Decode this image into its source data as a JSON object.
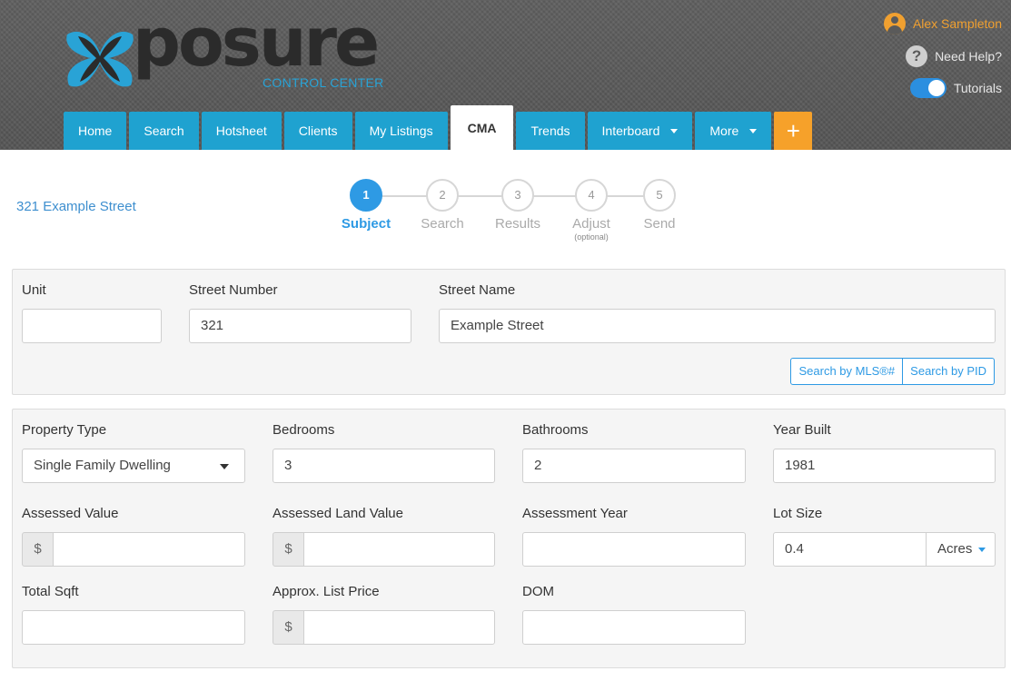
{
  "brand": {
    "logo_text": "posure",
    "logo_subtitle": "CONTROL CENTER",
    "logo_icon": "x-butterfly-logo-icon",
    "accent_color": "#29a3d6"
  },
  "user": {
    "name": "Alex Sampleton",
    "user_icon": "user-icon",
    "help_label": "Need Help?",
    "help_icon": "question-icon",
    "tutorials_label": "Tutorials",
    "tutorials_enabled": true
  },
  "nav": {
    "tabs": [
      {
        "label": "Home"
      },
      {
        "label": "Search"
      },
      {
        "label": "Hotsheet"
      },
      {
        "label": "Clients"
      },
      {
        "label": "My Listings"
      },
      {
        "label": "CMA",
        "active": true
      },
      {
        "label": "Trends"
      },
      {
        "label": "Interboard",
        "dropdown": true
      },
      {
        "label": "More",
        "dropdown": true
      },
      {
        "label": "+"
      }
    ],
    "tab_color": "#1fa2d0",
    "plus_color": "#f6a12a"
  },
  "subject_address": "321 Example Street",
  "wizard": {
    "steps": [
      {
        "number": "1",
        "label": "Subject",
        "active": true
      },
      {
        "number": "2",
        "label": "Search"
      },
      {
        "number": "3",
        "label": "Results"
      },
      {
        "number": "4",
        "label": "Adjust",
        "sublabel": "(optional)"
      },
      {
        "number": "5",
        "label": "Send"
      }
    ]
  },
  "address_panel": {
    "unit": {
      "label": "Unit",
      "value": ""
    },
    "street_number": {
      "label": "Street Number",
      "value": "321"
    },
    "street_name": {
      "label": "Street Name",
      "value": "Example Street"
    },
    "search_mls_label": "Search by MLS®#",
    "search_pid_label": "Search by PID"
  },
  "details_panel": {
    "property_type": {
      "label": "Property Type",
      "value": "Single Family Dwelling"
    },
    "bedrooms": {
      "label": "Bedrooms",
      "value": "3"
    },
    "bathrooms": {
      "label": "Bathrooms",
      "value": "2"
    },
    "year_built": {
      "label": "Year Built",
      "value": "1981"
    },
    "assessed_value": {
      "label": "Assessed Value",
      "prefix": "$",
      "value": ""
    },
    "assessed_land_value": {
      "label": "Assessed Land Value",
      "prefix": "$",
      "value": ""
    },
    "assessment_year": {
      "label": "Assessment Year",
      "value": ""
    },
    "lot_size": {
      "label": "Lot Size",
      "value": "0.4",
      "unit": "Acres"
    },
    "total_sqft": {
      "label": "Total Sqft",
      "value": ""
    },
    "approx_list_price": {
      "label": "Approx. List Price",
      "prefix": "$",
      "value": ""
    },
    "dom": {
      "label": "DOM",
      "value": ""
    }
  }
}
